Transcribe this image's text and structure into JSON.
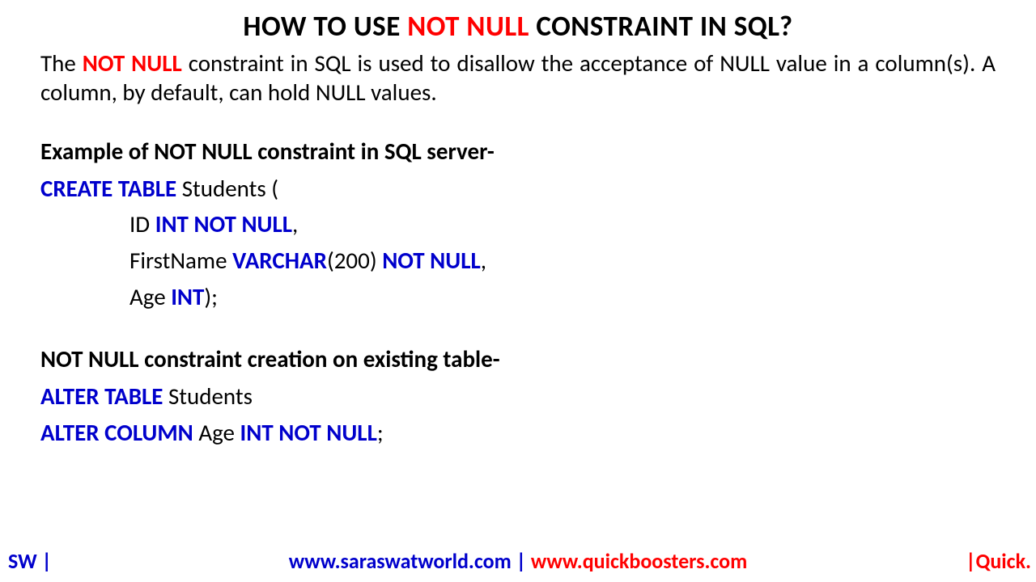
{
  "title": {
    "prefix": "HOW TO USE ",
    "highlight": "NOT NULL",
    "suffix": " CONSTRAINT IN SQL?"
  },
  "intro": {
    "seg1": "The ",
    "highlight": "NOT NULL",
    "seg2": " constraint in SQL is used to disallow the acceptance of NULL value in a column(s). A column, by default, can hold NULL values."
  },
  "example1": {
    "heading": "Example of NOT NULL constraint in SQL server-",
    "l1_kw": "CREATE TABLE",
    "l1_rest": " Students (",
    "l2_a": "ID ",
    "l2_kw": "INT NOT NULL",
    "l2_b": ",",
    "l3_a": "FirstName ",
    "l3_kw1": "VARCHAR",
    "l3_mid": "(200) ",
    "l3_kw2": "NOT NULL",
    "l3_b": ",",
    "l4_a": "Age ",
    "l4_kw": "INT",
    "l4_b": ");"
  },
  "example2": {
    "heading": "NOT NULL constraint creation on existing table-",
    "l1_kw": "ALTER TABLE",
    "l1_rest": " Students",
    "l2_kw1": "ALTER COLUMN",
    "l2_mid": " Age ",
    "l2_kw2": "INT NOT NULL",
    "l2_end": ";"
  },
  "footer": {
    "left": "SW |",
    "center1": "www.saraswatworld.com",
    "center_sep": " | ",
    "center2": "www.quickboosters.com",
    "right": "|Quick."
  }
}
